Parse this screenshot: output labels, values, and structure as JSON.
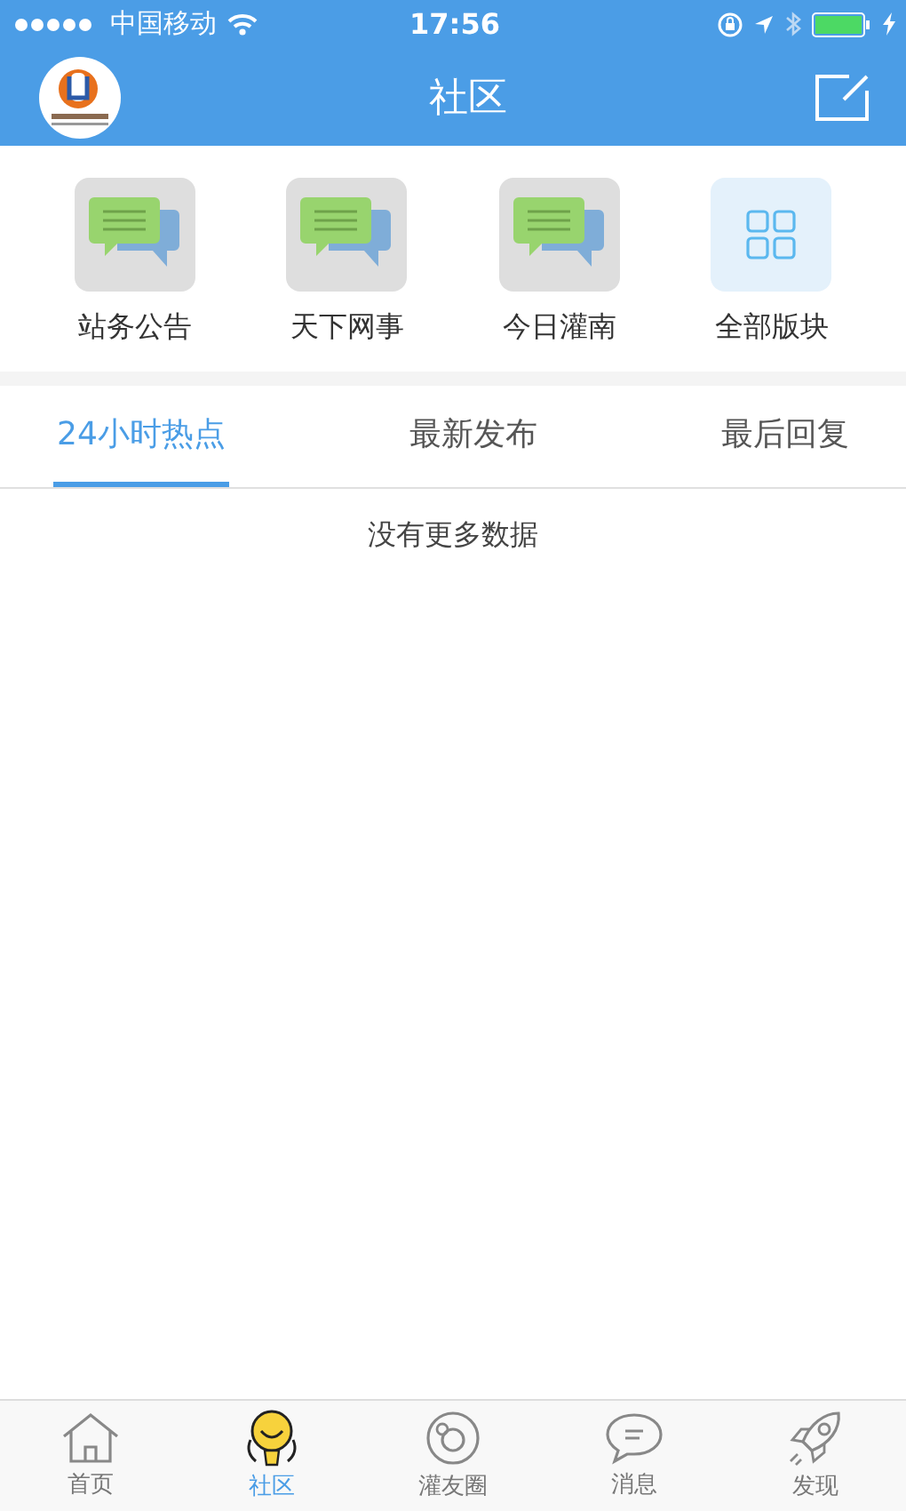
{
  "status_bar": {
    "carrier": "中国移动",
    "time": "17:56"
  },
  "header": {
    "title": "社区"
  },
  "boards": [
    {
      "label": "站务公告",
      "kind": "board"
    },
    {
      "label": "天下网事",
      "kind": "board"
    },
    {
      "label": "今日灌南",
      "kind": "board"
    },
    {
      "label": "全部版块",
      "kind": "all"
    }
  ],
  "tabs": [
    {
      "label": "24小时热点",
      "selected": true
    },
    {
      "label": "最新发布",
      "selected": false
    },
    {
      "label": "最后回复",
      "selected": false
    }
  ],
  "message": "没有更多数据",
  "tab_bar": [
    {
      "label": "首页",
      "kind": "home",
      "selected": false
    },
    {
      "label": "社区",
      "kind": "mascot",
      "selected": true
    },
    {
      "label": "灌友圈",
      "kind": "circle",
      "selected": false
    },
    {
      "label": "消息",
      "kind": "chat",
      "selected": false
    },
    {
      "label": "发现",
      "kind": "rocket",
      "selected": false
    }
  ]
}
